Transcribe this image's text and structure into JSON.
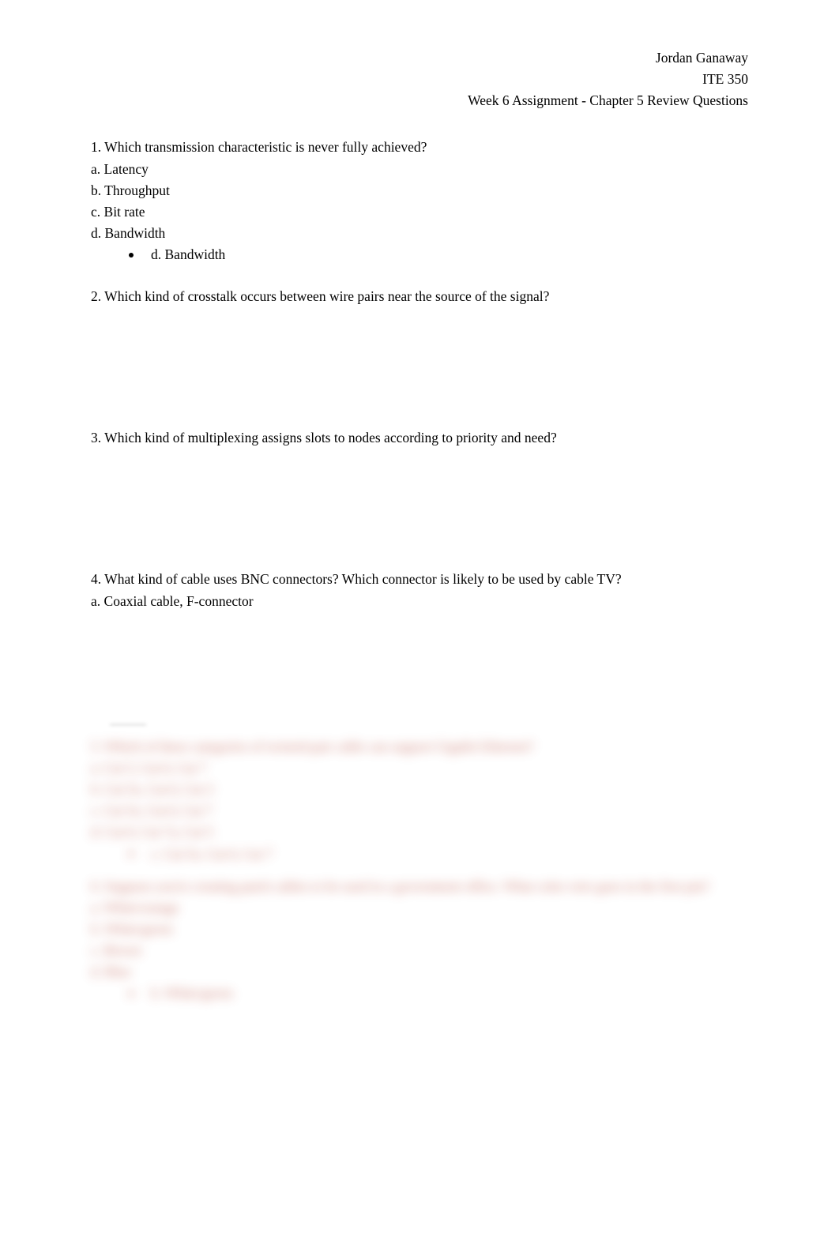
{
  "header": {
    "name": "Jordan Ganaway",
    "course": "ITE 350",
    "assignment": "Week 6 Assignment - Chapter 5 Review Questions"
  },
  "q1": {
    "prompt": "1. Which transmission characteristic is never fully achieved?",
    "a": "a. Latency",
    "b": "b. Throughput",
    "c": "c. Bit rate",
    "d": "d. Bandwidth",
    "answer": "d. Bandwidth"
  },
  "q2": {
    "prompt": "2. Which kind of crosstalk occurs between wire pairs near the source of the signal?"
  },
  "q3": {
    "prompt": "3. Which kind of multiplexing assigns slots to nodes according to priority and need?"
  },
  "q4": {
    "prompt": "4. What kind of cable uses BNC connectors? Which connector is likely to be used by cable TV?",
    "a": "a. Coaxial cable, F-connector"
  },
  "q5": {
    "prompt": "5. Which of these categories of twisted-pair cable can support Gigabit Ethernet?",
    "a": "a. Cat 5, Cat 6, Cat 7",
    "b": "b. Cat 5e, Cat 6, Cat 3",
    "c": "c. Cat 5e, Cat 6, Cat 7",
    "d": "d. Cat 6, Cat 7a, Cat 5",
    "answer": "c. Cat 5e, Cat 6, Cat 7"
  },
  "q6": {
    "prompt": "6. Suppose you're creating patch cables to be used in a government office. What color wire goes in the first pin?",
    "a": "a. White/orange",
    "b": "b. White/green",
    "c": "c. Brown",
    "d": "d. Blue",
    "answer": "b. White/green"
  }
}
